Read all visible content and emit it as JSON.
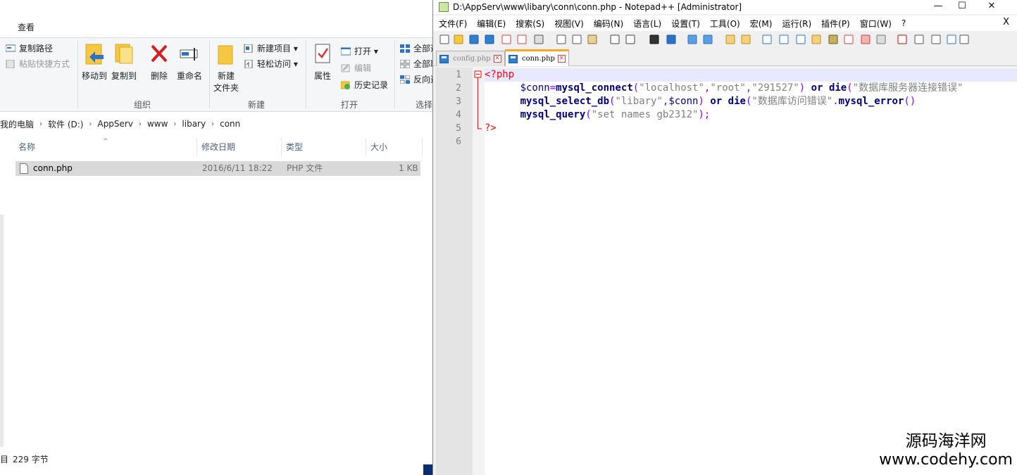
{
  "explorer": {
    "menu_tab": "查看",
    "ribbon": {
      "copy_path": "复制路径",
      "paste_shortcut": "粘贴快捷方式",
      "move_to": "移动到",
      "copy_to": "复制到",
      "delete": "删除",
      "rename": "重命名",
      "new_folder_line1": "新建",
      "new_folder_line2": "文件夹",
      "new_item": "新建项目 ▾",
      "easy_access": "轻松访问 ▾",
      "properties": "属性",
      "open": "打开 ▾",
      "edit": "编辑",
      "history": "历史记录",
      "select_all": "全部选",
      "select_none": "全部取",
      "invert_selection": "反向选",
      "group_organize": "组织",
      "group_new": "新建",
      "group_open": "打开",
      "group_select": "选择"
    },
    "breadcrumb": [
      "我的电脑",
      "软件 (D:)",
      "AppServ",
      "www",
      "libary",
      "conn"
    ],
    "columns": {
      "name": "名称",
      "modified": "修改日期",
      "type": "类型",
      "size": "大小"
    },
    "file": {
      "name": "conn.php",
      "modified": "2016/6/11 18:22",
      "type": "PHP 文件",
      "size": "1 KB"
    },
    "status": {
      "prefix": "目",
      "size": "229 字节"
    }
  },
  "notepad": {
    "title": "D:\\AppServ\\www\\libary\\conn\\conn.php - Notepad++ [Administrator]",
    "menu": [
      "文件(F)",
      "编辑(E)",
      "搜索(S)",
      "视图(V)",
      "编码(N)",
      "语言(L)",
      "设置(T)",
      "工具(O)",
      "宏(M)",
      "运行(R)",
      "插件(P)",
      "窗口(W)",
      "?"
    ],
    "menu_close": "X",
    "tabs": [
      {
        "label": "config.php",
        "active": false
      },
      {
        "label": "conn.php",
        "active": true
      }
    ],
    "line_numbers": [
      "1",
      "2",
      "3",
      "4",
      "5",
      "6"
    ],
    "code": {
      "l1": "<?php",
      "l2_indent": "      ",
      "l2_var": "$conn",
      "l2_eq": "=",
      "l2_fn": "mysql_connect",
      "l2_open": "(",
      "l2_s1": "\"localhost\"",
      "l2_c1": ",",
      "l2_s2": "\"root\"",
      "l2_c2": ",",
      "l2_s3": "\"291527\"",
      "l2_close": ")",
      "l2_or": " or ",
      "l2_die": "die",
      "l2_open2": "(",
      "l2_s4": "\"数据库服务器连接错误\"",
      "l3_indent": "      ",
      "l3_fn": "mysql_select_db",
      "l3_open": "(",
      "l3_s1": "\"libary\"",
      "l3_c1": ",",
      "l3_var": "$conn",
      "l3_close": ")",
      "l3_or": " or ",
      "l3_die": "die",
      "l3_open2": "(",
      "l3_s2": "\"数据库访问错误\"",
      "l3_dot": ".",
      "l3_fn2": "mysql_error",
      "l3_paren": "()",
      "l4_indent": "      ",
      "l4_fn": "mysql_query",
      "l4_open": "(",
      "l4_s1": "\"set names gb2312\"",
      "l4_close": ");",
      "l5": "?>"
    }
  },
  "watermark": {
    "line1": "源码海洋网",
    "line2": "www.codehy.com"
  },
  "colors": {
    "php_tag": "#ff0000",
    "keyword": "#000080",
    "operator": "#8000ff",
    "string": "#808080",
    "current_line": "#e8e8ff",
    "selected_file": "#d9d9d9"
  }
}
